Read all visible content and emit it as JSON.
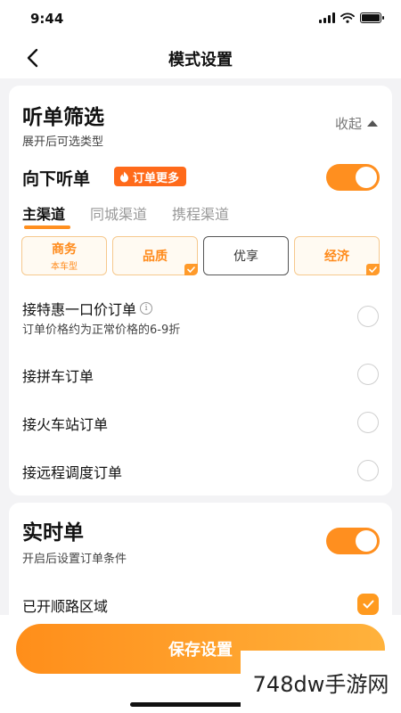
{
  "status_bar": {
    "time": "9:44",
    "battery_level": 1.0
  },
  "nav": {
    "title": "模式设置",
    "back_icon": "chevron-left-icon"
  },
  "listen_filter": {
    "title": "听单筛选",
    "subtitle": "展开后可选类型",
    "collapse_label": "收起",
    "listen_down": {
      "label": "向下听单",
      "badge": "订单更多",
      "badge_icon": "flame-icon",
      "enabled": true
    },
    "tabs": [
      {
        "label": "主渠道",
        "active": true
      },
      {
        "label": "同城渠道",
        "active": false
      },
      {
        "label": "携程渠道",
        "active": false
      }
    ],
    "types": [
      {
        "label": "商务",
        "sub": "本车型",
        "selected": true,
        "checked": false
      },
      {
        "label": "品质",
        "sub": "",
        "selected": true,
        "checked": true
      },
      {
        "label": "优享",
        "sub": "",
        "selected": false,
        "checked": false
      },
      {
        "label": "经济",
        "sub": "",
        "selected": true,
        "checked": true
      }
    ],
    "options": [
      {
        "label": "接特惠一口价订单",
        "sub": "订单价格约为正常价格的6-9折",
        "info_icon": "info-icon",
        "checked": false
      },
      {
        "label": "接拼车订单",
        "checked": false
      },
      {
        "label": "接火车站订单",
        "checked": false
      },
      {
        "label": "接远程调度订单",
        "checked": false
      }
    ]
  },
  "realtime": {
    "title": "实时单",
    "subtitle": "开启后设置订单条件",
    "enabled": true,
    "options": [
      {
        "label": "已开顺路区域",
        "checked": true
      }
    ]
  },
  "save_button": {
    "label": "保存设置"
  },
  "watermark": "748dw手游网",
  "colors": {
    "accent": "#FF8F1F",
    "badge": "#FF6A1A",
    "background": "#F3F3F5"
  }
}
